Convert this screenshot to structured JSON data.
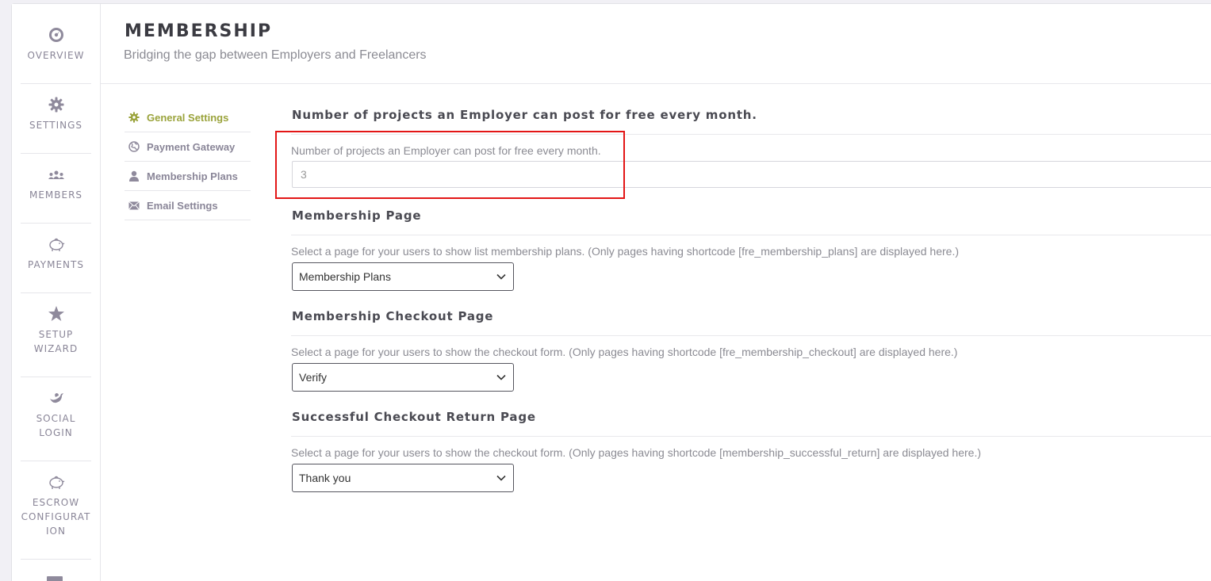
{
  "nav": {
    "items": [
      {
        "label": "OVERVIEW",
        "icon": "overview-icon"
      },
      {
        "label": "SETTINGS",
        "icon": "gear-icon"
      },
      {
        "label": "MEMBERS",
        "icon": "members-icon"
      },
      {
        "label": "PAYMENTS",
        "icon": "piggy-bank-icon"
      },
      {
        "label": "SETUP\nWIZARD",
        "icon": "star-icon"
      },
      {
        "label": "SOCIAL\nLOGIN",
        "icon": "twitter-bird-icon"
      },
      {
        "label": "ESCROW\nCONFIGURAT\nION",
        "icon": "piggy-bank-icon"
      }
    ]
  },
  "header": {
    "title": "MEMBERSHIP",
    "subtitle": "Bridging the gap between Employers and Freelancers"
  },
  "submenu": {
    "items": [
      {
        "label": "General Settings",
        "icon": "gear-icon",
        "active": true
      },
      {
        "label": "Payment Gateway",
        "icon": "globe-icon",
        "active": false
      },
      {
        "label": "Membership Plans",
        "icon": "user-icon",
        "active": false
      },
      {
        "label": "Email Settings",
        "icon": "envelope-icon",
        "active": false
      }
    ]
  },
  "sections": {
    "free_projects": {
      "title": "Number of projects an Employer can post for free every month.",
      "desc": "Number of projects an Employer can post for free every month.",
      "value": "3"
    },
    "membership_page": {
      "title": "Membership Page",
      "desc": "Select a page for your users to show list membership plans. (Only pages having shortcode [fre_membership_plans] are displayed here.)",
      "selected": "Membership Plans"
    },
    "checkout_page": {
      "title": "Membership Checkout Page",
      "desc": "Select a page for your users to show the checkout form. (Only pages having shortcode [fre_membership_checkout] are displayed here.)",
      "selected": "Verify"
    },
    "return_page": {
      "title": "Successful Checkout Return Page",
      "desc": "Select a page for your users to show the checkout form. (Only pages having shortcode [membership_successful_return] are displayed here.)",
      "selected": "Thank you"
    }
  },
  "colors": {
    "accent_active": "#9aa33b",
    "highlight": "#e31616",
    "nav_text": "#8a8698"
  }
}
